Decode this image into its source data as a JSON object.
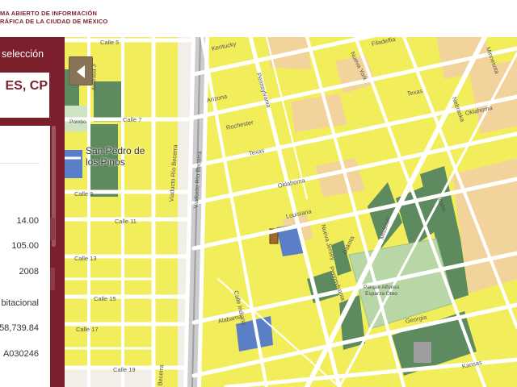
{
  "header": {
    "line1": "MA ABIERTO DE INFORMACIÓN",
    "line2": "RÁFICA DE LA CIUDAD DE MÉXICO"
  },
  "panel": {
    "heading": "selección",
    "title": "ES, CP",
    "title_tail": "",
    "values": [
      "14.00",
      "105.00",
      "2008",
      "bitacional",
      "58,739.84",
      "A030246"
    ]
  },
  "map": {
    "colonia": "San Pedro de los Pinos",
    "colonia_line1": "San Pedro de",
    "colonia_line2": "los Pinos",
    "park": "Parque Alfonso Esparza Oteo",
    "park_line1": "Parque Alfonso",
    "park_line2": "Esparza Oteo",
    "pombo": "Pombo",
    "streets": {
      "calle5": "Calle 5",
      "calle7": "Calle 7",
      "calle9": "Calle 9",
      "calle11": "Calle 11",
      "calle13": "Calle 13",
      "calle15": "Calle 15",
      "calle17": "Calle 17",
      "calle19": "Calle 19",
      "avenida3": "Avenida 3",
      "viaducto1": "Viaducto Río Becerra",
      "viaducto2": "Viaducto Río Becerra",
      "becerra": "Becerra",
      "kentucky": "Kentucky",
      "pennsylvania1": "Pennsylvania",
      "pennsylvania2": "Pennsylvania",
      "arizona": "Arizona",
      "rochester": "Rochester",
      "texas1": "Texas",
      "texas2": "Texas",
      "oklahoma1": "Oklahoma",
      "oklahoma2": "Oklahoma",
      "louisiana": "Louisiana",
      "indiana": "Calle Indiana",
      "alabama": "Alabama",
      "georgia": "Georgia",
      "kansas": "Kansas",
      "filadelfia": "Filadelfia",
      "newyork": "Nueva York",
      "nebraska": "Nebraska",
      "minnesota": "Minnesota",
      "idaho": "Idaho",
      "nuevajersey": "Nueva Jersey",
      "dakota": "Dakota",
      "missouri": "Missouri"
    }
  },
  "colors": {
    "panel": "#7a1f2b",
    "habitacional": "#f2ee5b",
    "areas_verdes": "#5d8a5e",
    "equipamiento": "#5b7fc7",
    "comercial": "#f2d39c",
    "selected": "#a06a2c"
  }
}
